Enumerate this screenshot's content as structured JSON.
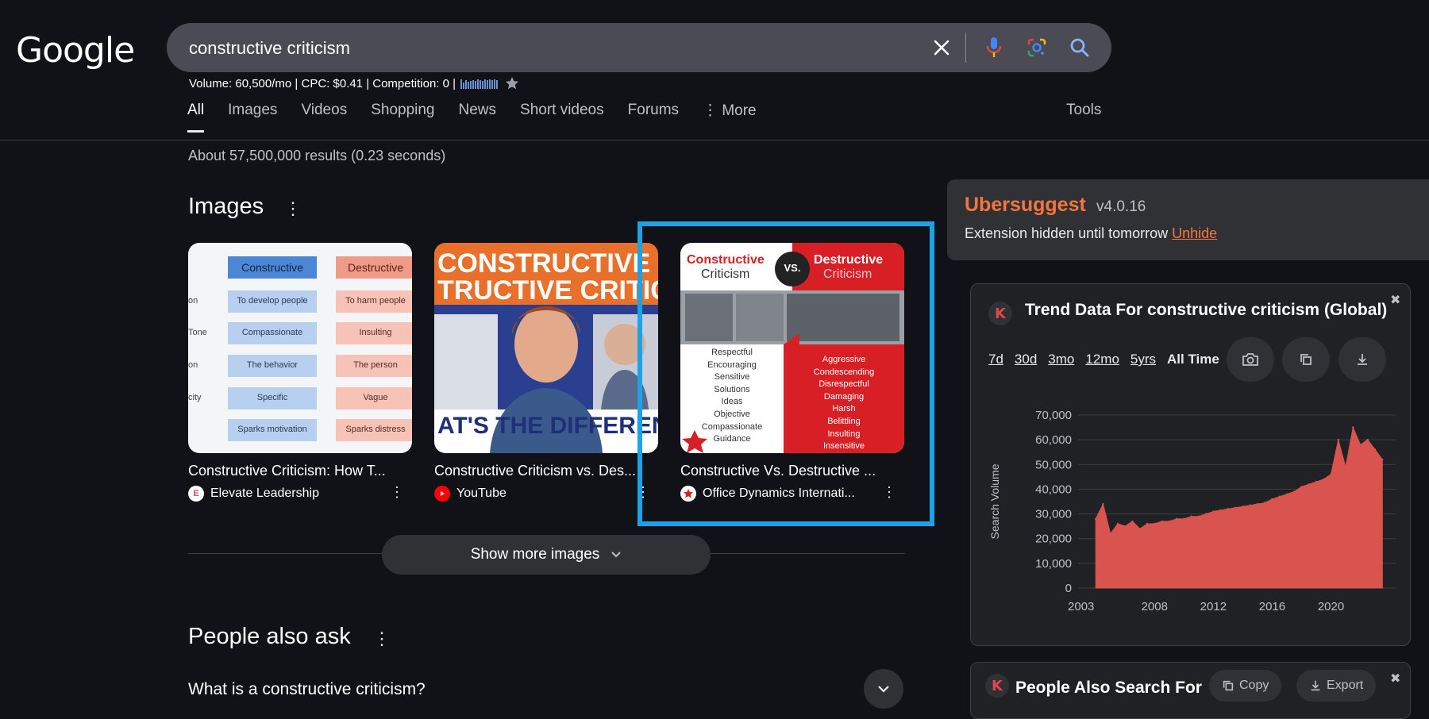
{
  "logo": "Google",
  "search": {
    "query": "constructive criticism"
  },
  "keyword_meta": "Volume: 60,500/mo | CPC: $0.41 | Competition: 0 |",
  "tabs": [
    {
      "label": "All",
      "active": true
    },
    {
      "label": "Images"
    },
    {
      "label": "Videos"
    },
    {
      "label": "Shopping"
    },
    {
      "label": "News"
    },
    {
      "label": "Short videos"
    },
    {
      "label": "Forums"
    },
    {
      "label": "⋮ More"
    }
  ],
  "tools_label": "Tools",
  "result_stats": "About 57,500,000 results (0.23 seconds)",
  "images_section": {
    "title": "Images",
    "cards": [
      {
        "caption": "Constructive Criticism: How T...",
        "source": "Elevate Leadership",
        "thumb": {
          "col1": "Constructive",
          "col2": "Destructive",
          "row_labels": [
            "on",
            "Tone",
            "on",
            "city",
            ""
          ],
          "left_items": [
            "To develop people",
            "Compassionate",
            "The behavior",
            "Specific",
            "Sparks motivation"
          ],
          "right_items": [
            "To harm people",
            "Insulting",
            "The person",
            "Vague",
            "Sparks distress"
          ]
        }
      },
      {
        "caption": "Constructive Criticism vs. Des...",
        "source": "YouTube",
        "thumb": {
          "line1": "CONSTRUCTIVE VS",
          "line2": "TRUCTIVE CRITIC",
          "bottom": "AT'S THE DIFFEREN"
        }
      },
      {
        "caption": "Constructive Vs. Destructive ...",
        "source": "Office Dynamics Internati...",
        "thumb": {
          "left_title": "Constructive",
          "left_sub": "Criticism",
          "vs": "VS.",
          "right_title": "Destructive",
          "right_sub": "Criticism",
          "left_list": [
            "Respectful",
            "Encouraging",
            "Sensitive",
            "Solutions",
            "Ideas",
            "Objective",
            "Compassionate",
            "Guidance"
          ],
          "right_list": [
            "Aggressive",
            "Condescending",
            "Disrespectful",
            "Damaging",
            "Harsh",
            "Belittling",
            "Insulting",
            "Insensitive"
          ]
        }
      }
    ],
    "show_more": "Show more images"
  },
  "paa": {
    "title": "People also ask",
    "question": "What is a constructive criticism?"
  },
  "ubersuggest": {
    "name": "Ubersuggest",
    "version": "v4.0.16",
    "message": "Extension hidden until tomorrow",
    "link": "Unhide"
  },
  "trend": {
    "title": "Trend Data For constructive criticism (Global)",
    "ranges": [
      "7d",
      "30d",
      "3mo",
      "12mo",
      "5yrs",
      "All Time"
    ],
    "active_range": "All Time"
  },
  "chart_data": {
    "type": "area",
    "ylabel": "Search Volume",
    "ylim": [
      0,
      70000
    ],
    "yticks": [
      "70,000",
      "60,000",
      "50,000",
      "40,000",
      "30,000",
      "20,000",
      "10,000",
      "0"
    ],
    "xticks": [
      "2003",
      "2008",
      "2012",
      "2016",
      "2020"
    ],
    "color": "#d9534f",
    "x": [
      2004.0,
      2004.5,
      2005.0,
      2005.5,
      2006.0,
      2006.5,
      2007.0,
      2007.5,
      2008.0,
      2008.5,
      2009.0,
      2009.5,
      2010.0,
      2010.5,
      2011.0,
      2011.5,
      2012.0,
      2012.5,
      2013.0,
      2013.5,
      2014.0,
      2014.5,
      2015.0,
      2015.5,
      2016.0,
      2016.5,
      2017.0,
      2017.5,
      2018.0,
      2018.5,
      2019.0,
      2019.5,
      2020.0,
      2020.5,
      2021.0,
      2021.5,
      2022.0,
      2022.5,
      2023.0,
      2023.5
    ],
    "y": [
      28000,
      34000,
      22000,
      26000,
      25000,
      27000,
      24000,
      26000,
      26000,
      27000,
      27000,
      28000,
      28000,
      29000,
      29000,
      30000,
      31000,
      31500,
      32000,
      32500,
      33000,
      33500,
      34000,
      34500,
      36000,
      37000,
      38000,
      39000,
      41000,
      42000,
      43000,
      44000,
      46000,
      60000,
      49000,
      65000,
      58000,
      60000,
      56000,
      52000
    ]
  },
  "people_also_search": {
    "title": "People Also Search For",
    "copy": "Copy",
    "export": "Export"
  }
}
